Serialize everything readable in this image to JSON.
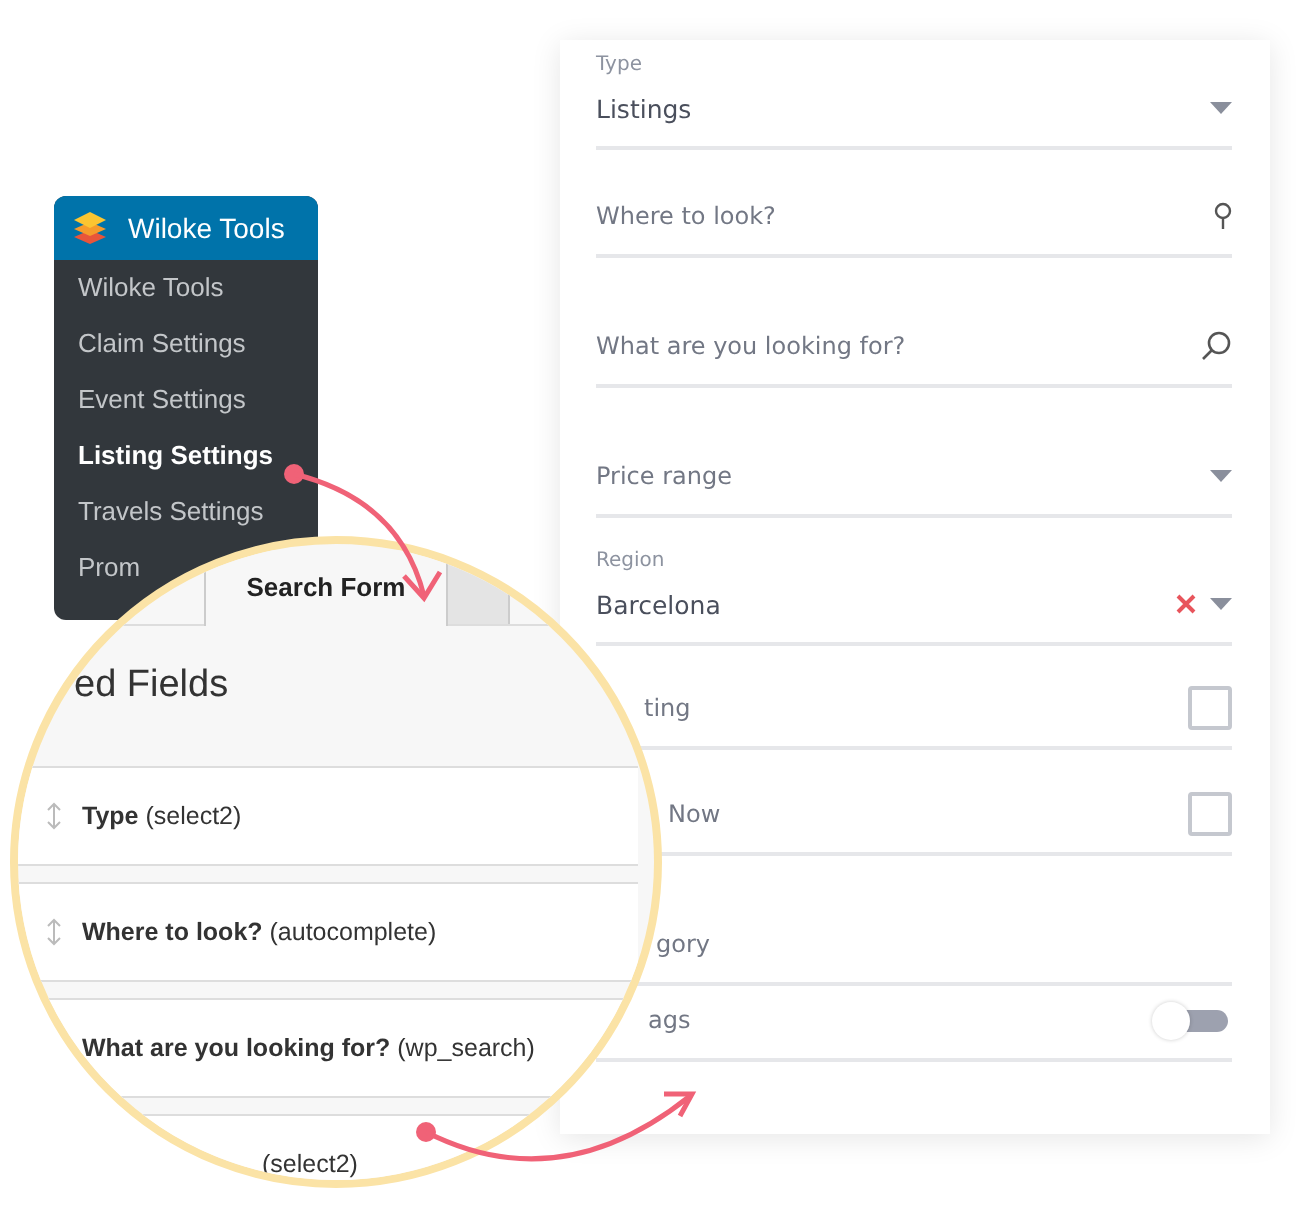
{
  "admin_menu": {
    "title": "Wiloke Tools",
    "items": [
      {
        "label": "Wiloke Tools",
        "selected": false
      },
      {
        "label": "Claim Settings",
        "selected": false
      },
      {
        "label": "Event Settings",
        "selected": false
      },
      {
        "label": "Listing Settings",
        "selected": true
      },
      {
        "label": "Travels Settings",
        "selected": false
      },
      {
        "label": "Prom",
        "selected": false
      }
    ]
  },
  "magnifier": {
    "tabs": [
      {
        "label": "Search Form",
        "selected": true
      }
    ],
    "heading": "ed Fields",
    "rows": [
      {
        "text": "**Type** (select2)",
        "handle": true
      },
      {
        "text": "**Where to look?** (autocomplete)",
        "handle": true
      },
      {
        "text": "**What are you looking for?** (wp_search)"
      },
      {
        "text": "(select2)"
      }
    ]
  },
  "search_form": {
    "fields": [
      {
        "kind": "select",
        "label": "Type",
        "value": "Listings"
      },
      {
        "kind": "location",
        "placeholder": "Where to look?"
      },
      {
        "kind": "search",
        "placeholder": "What are you looking for?"
      },
      {
        "kind": "select",
        "placeholder": "Price range"
      },
      {
        "kind": "select",
        "label": "Region",
        "value": "Barcelona",
        "clearable": true
      },
      {
        "kind": "checkbox",
        "label": "ting",
        "checked": false
      },
      {
        "kind": "checkbox",
        "label": "Now",
        "checked": false
      },
      {
        "kind": "plain",
        "label": "gory"
      },
      {
        "kind": "toggle",
        "label": "ags",
        "on": false
      }
    ]
  }
}
